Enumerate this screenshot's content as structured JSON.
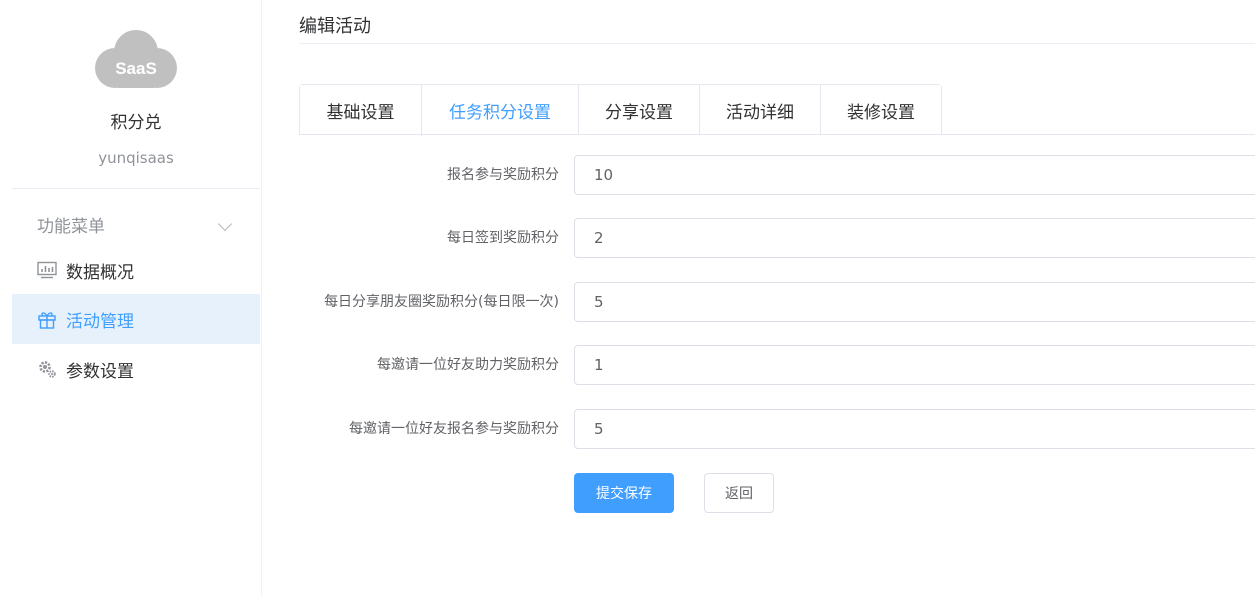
{
  "sidebar": {
    "logo_text": "SaaS",
    "brand_name": "积分兑",
    "brand_sub": "yunqisaas",
    "menu_group_label": "功能菜单",
    "items": [
      {
        "label": "数据概况",
        "icon": "dashboard-icon",
        "active": false
      },
      {
        "label": "活动管理",
        "icon": "gift-icon",
        "active": true
      },
      {
        "label": "参数设置",
        "icon": "gear-icon",
        "active": false
      }
    ]
  },
  "main": {
    "title": "编辑活动",
    "tabs": [
      {
        "label": "基础设置",
        "active": false
      },
      {
        "label": "任务积分设置",
        "active": true
      },
      {
        "label": "分享设置",
        "active": false
      },
      {
        "label": "活动详细",
        "active": false
      },
      {
        "label": "装修设置",
        "active": false
      }
    ],
    "form": [
      {
        "label": "报名参与奖励积分",
        "value": "10"
      },
      {
        "label": "每日签到奖励积分",
        "value": "2"
      },
      {
        "label": "每日分享朋友圈奖励积分(每日限一次)",
        "value": "5"
      },
      {
        "label": "每邀请一位好友助力奖励积分",
        "value": "1"
      },
      {
        "label": "每邀请一位好友报名参与奖励积分",
        "value": "5"
      }
    ],
    "submit_label": "提交保存",
    "back_label": "返回"
  },
  "colors": {
    "accent": "#409eff",
    "active_bg": "#e6f1fc",
    "logo_cloud": "#c0c0c0"
  }
}
